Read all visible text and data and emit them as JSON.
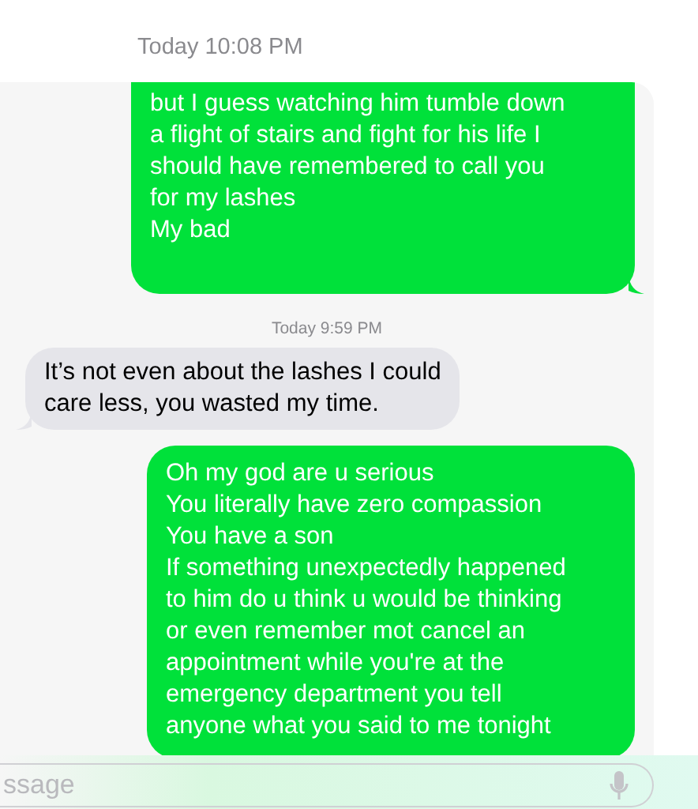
{
  "header": {
    "timestamp": "Today 10:08 PM"
  },
  "messages": [
    {
      "kind": "sent",
      "text": "but I guess watching him tumble down\na flight of stairs and fight for his life I\nshould have remembered to call you\nfor my lashes\nMy bad",
      "tail": true
    },
    {
      "kind": "timestamp",
      "text": "Today 9:59 PM"
    },
    {
      "kind": "received",
      "text": "It’s not even about the lashes I could\ncare less, you wasted my time.",
      "tail": true
    },
    {
      "kind": "sent",
      "text": "Oh my god are u serious\nYou literally have zero compassion\nYou have a son\nIf something unexpectedly happened\nto him do u think u would be thinking\nor even remember mot cancel an\nappointment while you're at the\nemergency department you tell\nanyone what you said to me tonight",
      "tail": false
    }
  ],
  "input": {
    "placeholder": "ssage"
  }
}
